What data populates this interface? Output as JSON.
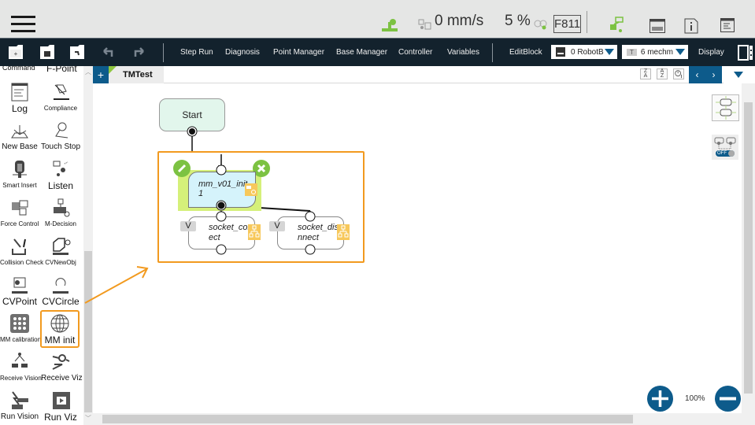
{
  "topbar": {
    "speed": "0 mm/s",
    "percent": "5 %",
    "fcode": "F811",
    "icons": [
      "menu-icon",
      "robot-arm-icon",
      "speed-icon",
      "plus-minus-icon",
      "robot-status-icon",
      "display-icon",
      "info-icon",
      "log-icon"
    ]
  },
  "toolbar": {
    "menus": [
      "Step Run",
      "Diagnosis",
      "Point Manager",
      "Base Manager",
      "Controller",
      "Variables"
    ],
    "editblock": "EditBlock",
    "base_dropdown": "0 RobotB",
    "tcp_badge": "T",
    "tcp_dropdown": "6 mechm",
    "display": "Display"
  },
  "sidebar": {
    "partial_top": [
      "Command",
      "F-Point"
    ],
    "items": [
      {
        "label": "Log",
        "size": "big",
        "icon": "log-icon"
      },
      {
        "label": "Compliance",
        "size": "small",
        "icon": "compliance-icon"
      },
      {
        "label": "New Base",
        "size": "mid",
        "icon": "new-base-icon"
      },
      {
        "label": "Touch Stop",
        "size": "mid",
        "icon": "touch-stop-icon"
      },
      {
        "label": "Smart Insert",
        "size": "small",
        "icon": "smart-insert-icon"
      },
      {
        "label": "Listen",
        "size": "big",
        "icon": "listen-icon"
      },
      {
        "label": "Force Control",
        "size": "small",
        "icon": "force-control-icon"
      },
      {
        "label": "M-Decision",
        "size": "small",
        "icon": "m-decision-icon"
      },
      {
        "label": "Collision Check",
        "size": "small",
        "icon": "collision-check-icon"
      },
      {
        "label": "CVNewObj",
        "size": "small",
        "icon": "cv-new-obj-icon"
      },
      {
        "label": "CVPoint",
        "size": "big",
        "icon": "cv-point-icon"
      },
      {
        "label": "CVCircle",
        "size": "big",
        "icon": "cv-circle-icon"
      },
      {
        "label": "MM calibration",
        "size": "small",
        "icon": "mm-calibration-icon"
      },
      {
        "label": "MM init",
        "size": "big",
        "icon": "globe-icon",
        "highlighted": true
      },
      {
        "label": "Receive Vision",
        "size": "small",
        "icon": "receive-vision-icon"
      },
      {
        "label": "Receive Viz",
        "size": "mid",
        "icon": "receive-viz-icon"
      },
      {
        "label": "Run Vision",
        "size": "mid",
        "icon": "run-vision-icon"
      },
      {
        "label": "Run Viz",
        "size": "big",
        "icon": "run-viz-icon"
      }
    ]
  },
  "canvas": {
    "tab": "TMTest",
    "add_tab": "+",
    "sort_za": "Z\nA",
    "sort_az": "A\nZ",
    "flow": {
      "start": "Start",
      "init_node": "mm_v01_init\n1",
      "sub_nodes": [
        {
          "badge": "V",
          "label": "socket_conn\nect"
        },
        {
          "badge": "V",
          "label": "socket_disco\nnnect"
        }
      ]
    },
    "toggle": "OFF",
    "zoom_level": "100%",
    "accent": "#f29a1f",
    "brand": "#0d5b8b",
    "green": "#7cc242"
  }
}
